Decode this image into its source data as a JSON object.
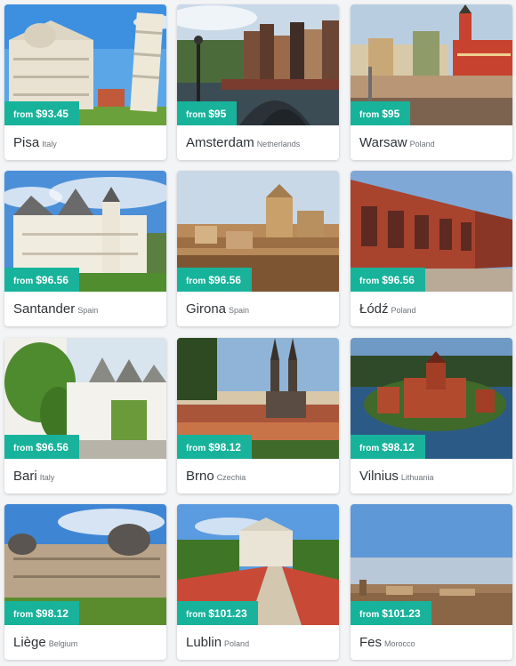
{
  "price_prefix": "from",
  "cards": [
    {
      "city": "Pisa",
      "country": "Italy",
      "price": "$93.45",
      "image": "leaning-tower-cathedral"
    },
    {
      "city": "Amsterdam",
      "country": "Netherlands",
      "price": "$95",
      "image": "canal-bridge-houses"
    },
    {
      "city": "Warsaw",
      "country": "Poland",
      "price": "$95",
      "image": "castle-square"
    },
    {
      "city": "Santander",
      "country": "Spain",
      "price": "$96.56",
      "image": "white-palace"
    },
    {
      "city": "Girona",
      "country": "Spain",
      "price": "$96.56",
      "image": "hilltop-cathedral"
    },
    {
      "city": "Łódź",
      "country": "Poland",
      "price": "$96.56",
      "image": "red-brick-factory"
    },
    {
      "city": "Bari",
      "country": "Italy",
      "price": "$96.56",
      "image": "trulli-street"
    },
    {
      "city": "Brno",
      "country": "Czechia",
      "price": "$98.12",
      "image": "twin-spire-cathedral"
    },
    {
      "city": "Vilnius",
      "country": "Lithuania",
      "price": "$98.12",
      "image": "island-castle"
    },
    {
      "city": "Liège",
      "country": "Belgium",
      "price": "$98.12",
      "image": "domed-palace"
    },
    {
      "city": "Lublin",
      "country": "Poland",
      "price": "$101.23",
      "image": "castle-bridge"
    },
    {
      "city": "Fes",
      "country": "Morocco",
      "price": "$101.23",
      "image": "city-panorama"
    }
  ]
}
